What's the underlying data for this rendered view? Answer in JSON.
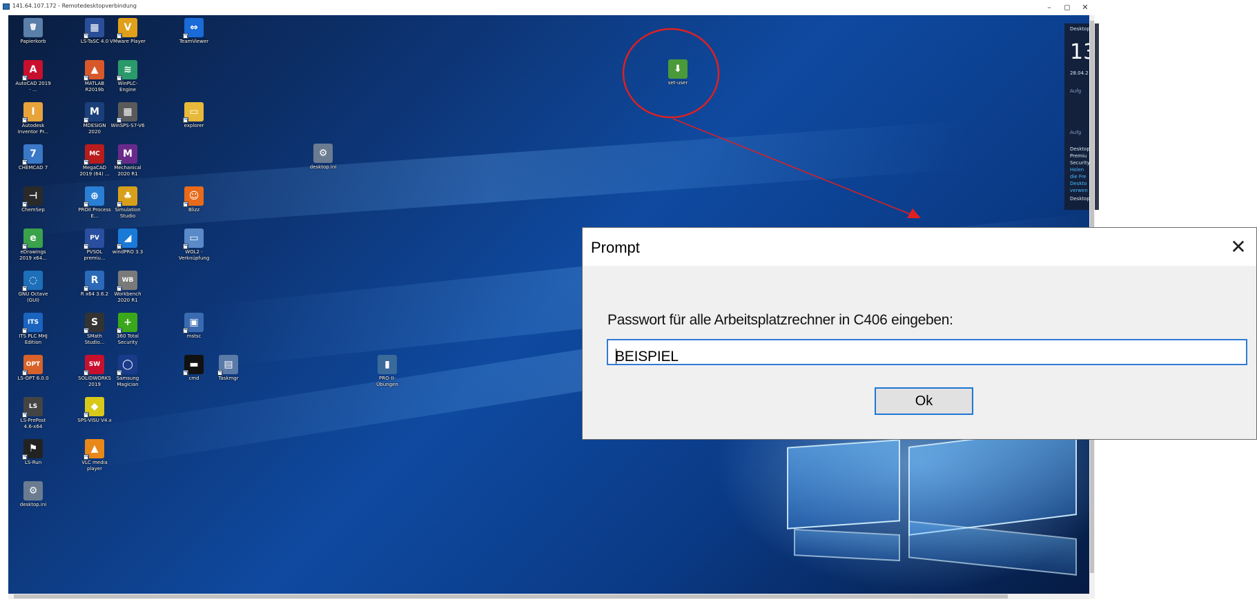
{
  "rdp": {
    "title": "141.64.107.172 - Remotedesktopverbindung",
    "minimize": "–",
    "maximize": "◻",
    "close": "✕"
  },
  "desktop": {
    "icons": [
      {
        "id": "papierkorb",
        "label": "Papierkorb",
        "glyph": "🗑",
        "color": "#5a7fa8"
      },
      {
        "id": "autocad",
        "label": "AutoCAD 2019 - ...",
        "glyph": "A",
        "color": "#c8102e"
      },
      {
        "id": "inventor",
        "label": "Autodesk Inventor Pr...",
        "glyph": "I",
        "color": "#e8a33a"
      },
      {
        "id": "chemcad",
        "label": "CHEMCAD 7",
        "glyph": "7",
        "color": "#3a78c8"
      },
      {
        "id": "chemsep",
        "label": "ChemSep",
        "glyph": "⊣",
        "color": "#2a2a2a"
      },
      {
        "id": "edrawings",
        "label": "eDrawings 2019 x64...",
        "glyph": "e",
        "color": "#3aa24a"
      },
      {
        "id": "octave",
        "label": "GNU Octave (GUI)",
        "glyph": "◌",
        "color": "#1c6fb8"
      },
      {
        "id": "itsplc",
        "label": "ITS PLC MHJ Edition",
        "glyph": "ITS",
        "color": "#1a64c0"
      },
      {
        "id": "lsopt",
        "label": "LS-OPT 6.0.0",
        "glyph": "OPT",
        "color": "#d8622a"
      },
      {
        "id": "lsprepost",
        "label": "LS-PrePost 4.6-x64",
        "glyph": "LS",
        "color": "#444444"
      },
      {
        "id": "lsrun",
        "label": "LS-Run",
        "glyph": "⚑",
        "color": "#222222"
      },
      {
        "id": "desktopini1",
        "label": "desktop.ini",
        "glyph": "⚙",
        "color": "#6b7b90"
      },
      {
        "id": "lstasc",
        "label": "LS-TaSC 4.0",
        "glyph": "▦",
        "color": "#2a4f9a"
      },
      {
        "id": "matlab",
        "label": "MATLAB R2019b",
        "glyph": "▲",
        "color": "#d8582a"
      },
      {
        "id": "mdesign",
        "label": "MDESIGN 2020",
        "glyph": "M",
        "color": "#1a3f7a"
      },
      {
        "id": "megacad",
        "label": "MegaCAD 2019 (64) ...",
        "glyph": "MC",
        "color": "#b81c1c"
      },
      {
        "id": "proii",
        "label": "PROII Process E...",
        "glyph": "⊕",
        "color": "#2a7fd4"
      },
      {
        "id": "pvsol",
        "label": "PVSOL premiu...",
        "glyph": "PV",
        "color": "#2a4fa0"
      },
      {
        "id": "rx64",
        "label": "R x64 3.6.2",
        "glyph": "R",
        "color": "#2a6ab8"
      },
      {
        "id": "smath",
        "label": "SMath Studio...",
        "glyph": "S",
        "color": "#333333"
      },
      {
        "id": "solidworks",
        "label": "SOLIDWORKS 2019",
        "glyph": "SW",
        "color": "#c8102e"
      },
      {
        "id": "spsvisu",
        "label": "SPS-VISU V4.x",
        "glyph": "◆",
        "color": "#d8c81a"
      },
      {
        "id": "vlc",
        "label": "VLC media player",
        "glyph": "▲",
        "color": "#e8881a"
      },
      {
        "id": "vmware",
        "label": "VMware Player",
        "glyph": "V",
        "color": "#e0a01a"
      },
      {
        "id": "winplc",
        "label": "WinPLC-Engine",
        "glyph": "≋",
        "color": "#2a9a6a"
      },
      {
        "id": "winsps",
        "label": "WinSPS-S7-V6",
        "glyph": "▦",
        "color": "#5a5a5a"
      },
      {
        "id": "mechanical",
        "label": "Mechanical 2020 R1",
        "glyph": "M",
        "color": "#6a2a8a"
      },
      {
        "id": "simstudio",
        "label": "Simulation Studio",
        "glyph": "♣",
        "color": "#d8a01a"
      },
      {
        "id": "windpro",
        "label": "windPRO 3.3",
        "glyph": "◢",
        "color": "#1a7ad8"
      },
      {
        "id": "workbench",
        "label": "Workbench 2020 R1",
        "glyph": "WB",
        "color": "#7a7a7a"
      },
      {
        "id": "totalsec",
        "label": "360 Total Security",
        "glyph": "+",
        "color": "#3aa81a"
      },
      {
        "id": "samsung",
        "label": "Samsung Magician",
        "glyph": "◯",
        "color": "#1a3a8a"
      },
      {
        "id": "teamviewer",
        "label": "TeamViewer",
        "glyph": "⇔",
        "color": "#1a6ad8"
      },
      {
        "id": "explorer",
        "label": "explorer",
        "glyph": "▭",
        "color": "#e8b83a"
      },
      {
        "id": "blizz",
        "label": "Blizz",
        "glyph": "☺",
        "color": "#e86a1a"
      },
      {
        "id": "wol2",
        "label": "WOL2 - Verknüpfung",
        "glyph": "▭",
        "color": "#5a8ac8"
      },
      {
        "id": "mstsc",
        "label": "mstsc",
        "glyph": "▣",
        "color": "#3a6ab0"
      },
      {
        "id": "cmd",
        "label": "cmd",
        "glyph": "▬",
        "color": "#111111"
      },
      {
        "id": "taskmgr",
        "label": "Taskmgr",
        "glyph": "▤",
        "color": "#5a7aa8"
      },
      {
        "id": "desktopini2",
        "label": "desktop.ini",
        "glyph": "⚙",
        "color": "#6b7b90"
      },
      {
        "id": "proii-uebung",
        "label": "PRO-II-Übungen",
        "glyph": "▮",
        "color": "#3a6a9a"
      },
      {
        "id": "set-user",
        "label": "set-user",
        "glyph": "⬇",
        "color": "#4a9a3a"
      }
    ]
  },
  "side_panel": {
    "title": "Desktop",
    "time": "13",
    "date": "28.04.2",
    "rows": [
      "Aufg",
      "",
      "Aufg",
      "Desktop",
      "Premiu",
      "Security",
      "Holen",
      "die Fre",
      "Deskto",
      "verwen",
      "Desktop"
    ]
  },
  "colors": {
    "annotation": "#e02020",
    "accent": "#2f7bd4"
  },
  "dialog": {
    "title": "Prompt",
    "close_label": "✕",
    "message": "Passwort für alle Arbeitsplatzrechner in C406 eingeben:",
    "input_value": "BEISPIEL",
    "ok_label": "Ok"
  }
}
